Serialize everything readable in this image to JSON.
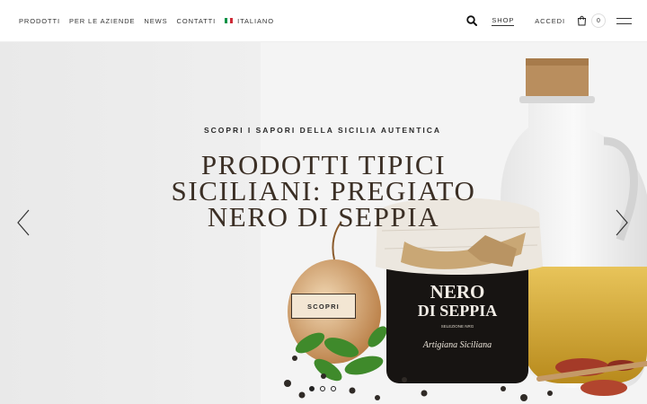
{
  "nav": {
    "items": [
      "PRODOTTI",
      "PER LE AZIENDE",
      "NEWS",
      "CONTATTI"
    ],
    "language": "ITALIANO"
  },
  "header": {
    "shop_label": "SHOP",
    "login_label": "ACCEDI",
    "cart_count": "0"
  },
  "hero": {
    "eyebrow": "SCOPRI I SAPORI DELLA SICILIA AUTENTICA",
    "headline": "PRODOTTI TIPICI SICILIANI: PREGIATO NERO DI SEPPIA",
    "cta_label": "SCOPRI",
    "jar_label_line1": "NERO",
    "jar_label_line2": "DI SEPPIA",
    "jar_small_text": "SELEZIONE NRG",
    "jar_brand": "Artigiana Siciliana",
    "slides": 3,
    "active_slide": 1
  },
  "colors": {
    "accent": "#3b2f25",
    "cta_background": "#f3e6d3",
    "flag": [
      "#009246",
      "#ffffff",
      "#ce2b37"
    ]
  }
}
